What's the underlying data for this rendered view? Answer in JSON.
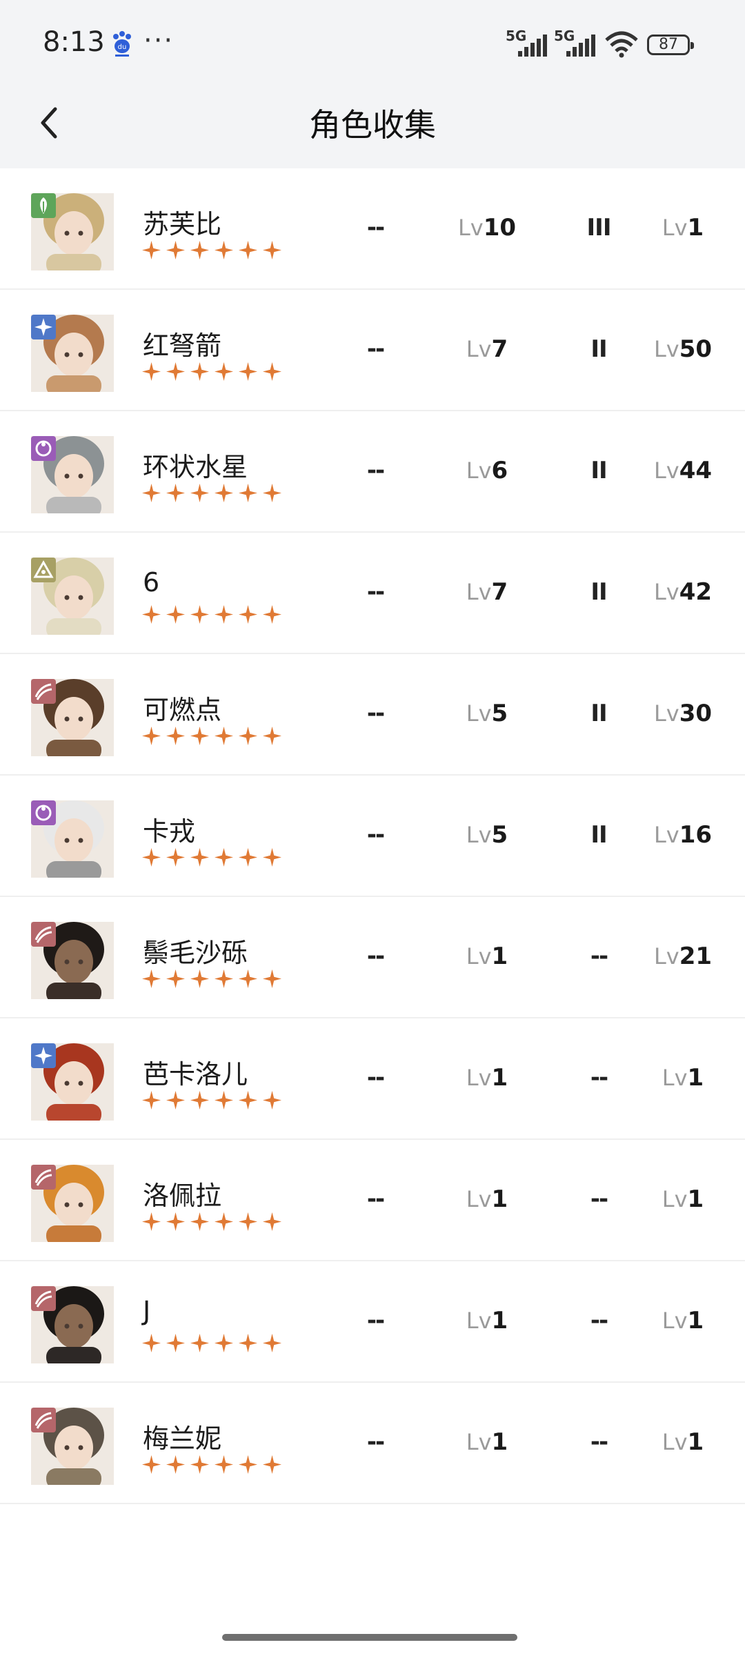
{
  "status_bar": {
    "time": "8:13",
    "net1": "5G",
    "net2": "5G",
    "battery": "87"
  },
  "header": {
    "title": "角色收集"
  },
  "level_prefix": "Lv",
  "colors": {
    "star": "#e07a35",
    "elem_green": "#5ea55a",
    "elem_blue": "#4f78c8",
    "elem_purple": "#9a5cb7",
    "elem_olive": "#a7a064",
    "elem_red": "#b5666a"
  },
  "characters": [
    {
      "name": "",
      "element": "red",
      "c1": "--",
      "lv": "10",
      "rank": "III",
      "lv2": "1"
    },
    {
      "name": "苏芙比",
      "element": "green",
      "c1": "--",
      "lv": "10",
      "rank": "III",
      "lv2": "1"
    },
    {
      "name": "红弩箭",
      "element": "blue",
      "c1": "--",
      "lv": "7",
      "rank": "II",
      "lv2": "50"
    },
    {
      "name": "环状水星",
      "element": "purple",
      "c1": "--",
      "lv": "6",
      "rank": "II",
      "lv2": "44"
    },
    {
      "name": "6",
      "element": "olive",
      "c1": "--",
      "lv": "7",
      "rank": "II",
      "lv2": "42"
    },
    {
      "name": "可燃点",
      "element": "red",
      "c1": "--",
      "lv": "5",
      "rank": "II",
      "lv2": "30"
    },
    {
      "name": "卡戎",
      "element": "purple",
      "c1": "--",
      "lv": "5",
      "rank": "II",
      "lv2": "16"
    },
    {
      "name": "鬃毛沙砾",
      "element": "red",
      "c1": "--",
      "lv": "1",
      "rank": "--",
      "lv2": "21"
    },
    {
      "name": "芭卡洛儿",
      "element": "blue",
      "c1": "--",
      "lv": "1",
      "rank": "--",
      "lv2": "1"
    },
    {
      "name": "洛佩拉",
      "element": "red",
      "c1": "--",
      "lv": "1",
      "rank": "--",
      "lv2": "1"
    },
    {
      "name": "J",
      "element": "red",
      "c1": "--",
      "lv": "1",
      "rank": "--",
      "lv2": "1"
    },
    {
      "name": "梅兰妮",
      "element": "red",
      "c1": "--",
      "lv": "1",
      "rank": "--",
      "lv2": "1"
    }
  ],
  "star_count": 6
}
